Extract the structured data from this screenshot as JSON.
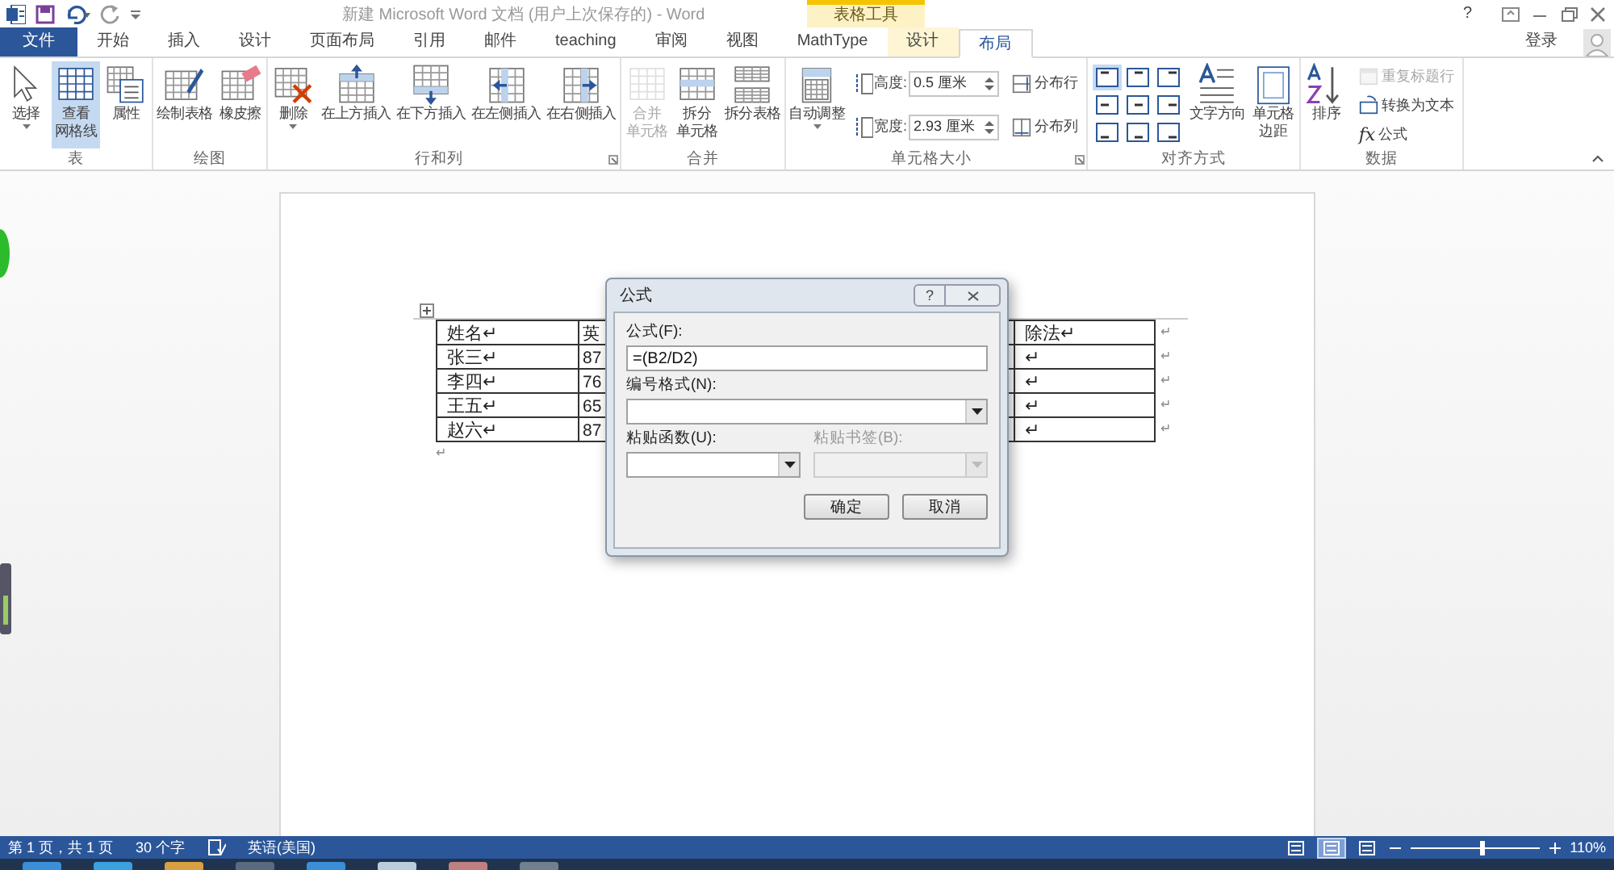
{
  "title_bar": {
    "title": "新建 Microsoft Word 文档 (用户上次保存的) - Word",
    "help": "?"
  },
  "context_header": "表格工具",
  "tabs": [
    {
      "label": "文件",
      "kind": "file",
      "selected": false
    },
    {
      "label": "开始",
      "kind": "normal",
      "selected": false
    },
    {
      "label": "插入",
      "kind": "normal",
      "selected": false
    },
    {
      "label": "设计",
      "kind": "normal",
      "selected": false
    },
    {
      "label": "页面布局",
      "kind": "normal",
      "selected": false
    },
    {
      "label": "引用",
      "kind": "normal",
      "selected": false
    },
    {
      "label": "邮件",
      "kind": "normal",
      "selected": false
    },
    {
      "label": "teaching",
      "kind": "normal",
      "selected": false
    },
    {
      "label": "审阅",
      "kind": "normal",
      "selected": false
    },
    {
      "label": "视图",
      "kind": "normal",
      "selected": false
    },
    {
      "label": "MathType",
      "kind": "normal",
      "selected": false
    },
    {
      "label": "设计",
      "kind": "context",
      "selected": false
    },
    {
      "label": "布局",
      "kind": "context",
      "selected": true
    }
  ],
  "account": {
    "label": "登录"
  },
  "ribbon": {
    "groups": [
      {
        "label": "表",
        "items": [
          {
            "kind": "large",
            "lines": [
              "选择"
            ],
            "dropdown": true,
            "selected": false,
            "disabled": false
          },
          {
            "kind": "large",
            "lines": [
              "查看",
              "网格线"
            ],
            "selected": true,
            "disabled": false
          },
          {
            "kind": "large",
            "lines": [
              "属性"
            ],
            "selected": false,
            "disabled": false
          }
        ]
      },
      {
        "label": "绘图",
        "items": [
          {
            "kind": "large",
            "lines": [
              "绘制表格"
            ],
            "selected": false,
            "disabled": false
          },
          {
            "kind": "large",
            "lines": [
              "橡皮擦"
            ],
            "selected": false,
            "disabled": false
          }
        ]
      },
      {
        "label": "行和列",
        "launcher": true,
        "items": [
          {
            "kind": "large",
            "lines": [
              "删除"
            ],
            "dropdown": true,
            "selected": false,
            "disabled": false
          },
          {
            "kind": "large",
            "lines": [
              "在上方插入"
            ],
            "selected": false,
            "disabled": false
          },
          {
            "kind": "large",
            "lines": [
              "在下方插入"
            ],
            "selected": false,
            "disabled": false
          },
          {
            "kind": "large",
            "lines": [
              "在左侧插入"
            ],
            "selected": false,
            "disabled": false
          },
          {
            "kind": "large",
            "lines": [
              "在右侧插入"
            ],
            "selected": false,
            "disabled": false
          }
        ]
      },
      {
        "label": "合并",
        "items": [
          {
            "kind": "large",
            "lines": [
              "合并",
              "单元格"
            ],
            "selected": false,
            "disabled": true
          },
          {
            "kind": "large",
            "lines": [
              "拆分",
              "单元格"
            ],
            "selected": false,
            "disabled": false
          },
          {
            "kind": "large",
            "lines": [
              "拆分表格"
            ],
            "selected": false,
            "disabled": false
          }
        ]
      },
      {
        "label": "单元格大小",
        "launcher": true,
        "items": [
          {
            "kind": "large",
            "lines": [
              "自动调整"
            ],
            "dropdown": true,
            "selected": false,
            "disabled": false
          },
          {
            "kind": "stack",
            "items": [
              {
                "kind": "spin",
                "label": "高度:",
                "value": "0.5 厘米"
              },
              {
                "kind": "spin",
                "label": "宽度:",
                "value": "2.93 厘米"
              }
            ]
          },
          {
            "kind": "stack",
            "items": [
              {
                "kind": "small",
                "label": "分布行",
                "disabled": false
              },
              {
                "kind": "small",
                "label": "分布列",
                "disabled": false
              }
            ]
          }
        ]
      },
      {
        "label": "对齐方式",
        "items": [
          {
            "kind": "align",
            "cells": [
              {
                "selected": true
              },
              {
                "selected": false
              },
              {
                "selected": false
              },
              {
                "selected": false
              },
              {
                "selected": false
              },
              {
                "selected": false
              },
              {
                "selected": false
              },
              {
                "selected": false
              },
              {
                "selected": false
              }
            ]
          },
          {
            "kind": "large",
            "lines": [
              "文字方向"
            ],
            "selected": false,
            "disabled": false
          },
          {
            "kind": "large",
            "lines": [
              "单元格",
              "边距"
            ],
            "selected": false,
            "disabled": false
          }
        ]
      },
      {
        "label": "数据",
        "items": [
          {
            "kind": "large",
            "lines": [
              "排序"
            ],
            "selected": false,
            "disabled": false
          },
          {
            "kind": "stack",
            "items": [
              {
                "kind": "small",
                "label": "重复标题行",
                "disabled": true
              },
              {
                "kind": "small",
                "label": "转换为文本",
                "disabled": false
              },
              {
                "kind": "small",
                "label": "公式",
                "icon_text": "fx",
                "disabled": false
              }
            ]
          }
        ]
      }
    ]
  },
  "document": {
    "table": {
      "rows": [
        {
          "cells": [
            "姓名↵",
            "英",
            "除法↵"
          ],
          "end_mark": "↵"
        },
        {
          "cells": [
            "张三↵",
            "87",
            "↵"
          ],
          "end_mark": "↵"
        },
        {
          "cells": [
            "李四↵",
            "76",
            "↵"
          ],
          "end_mark": "↵"
        },
        {
          "cells": [
            "王五↵",
            "65",
            "↵"
          ],
          "end_mark": "↵"
        },
        {
          "cells": [
            "赵六↵",
            "87",
            "↵"
          ],
          "end_mark": "↵"
        }
      ]
    },
    "after_table": "↵"
  },
  "dialog": {
    "title": "公式",
    "help": "?",
    "formula": {
      "label": "公式(F):",
      "value": "=(B2/D2)"
    },
    "number_format": {
      "label": "编号格式(N):"
    },
    "paste": [
      {
        "label": "粘贴函数(U):",
        "disabled": false
      },
      {
        "label": "粘贴书签(B):",
        "disabled": true
      }
    ],
    "buttons": [
      "确定",
      "取消"
    ]
  },
  "status_bar": {
    "page": "第 1 页，共 1 页",
    "words": "30 个字",
    "language": "英语(美国)",
    "views": [
      {
        "selected": false
      },
      {
        "selected": true
      },
      {
        "selected": false
      }
    ],
    "zoom": {
      "level": 0.55,
      "reading": "110%"
    }
  }
}
